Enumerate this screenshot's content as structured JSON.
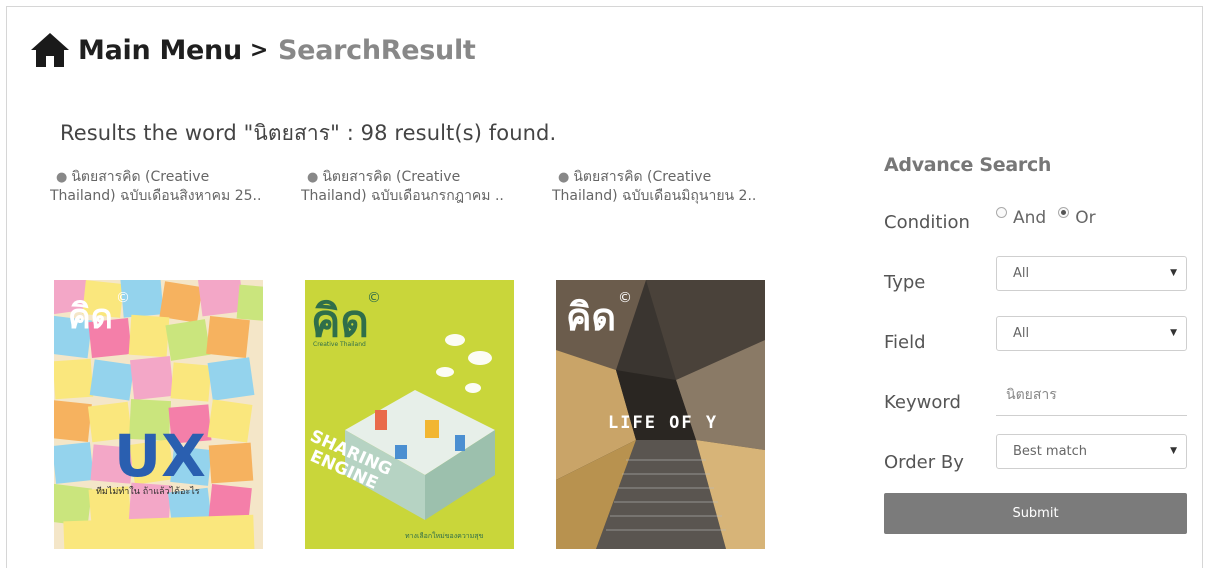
{
  "header": {
    "main_menu": "Main Menu",
    "separator": ">",
    "current": "SearchResult"
  },
  "summary": "Results the word \"นิตยสาร\" : 98 result(s) found.",
  "results": [
    {
      "title": "นิตยสารคิด (Creative Thailand) ฉบับเดือนสิงหาคม 25..",
      "cover_headline": "UX",
      "cover_subtitle": "ทีมไม่ทำใน ถ้าแล้วได้อะไร"
    },
    {
      "title": "นิตยสารคิด (Creative Thailand) ฉบับเดือนกรกฎาคม ..",
      "cover_headline": "SHARING ENGINE",
      "cover_subtitle": "ทางเลือกใหม่ของความสุข"
    },
    {
      "title": "นิตยสารคิด (Creative Thailand) ฉบับเดือนมิถุนายน 2..",
      "cover_headline": "LIFE OF Y",
      "cover_subtitle": ""
    }
  ],
  "covers": {
    "logo": "คิด",
    "logo_sub": "Creative Thailand",
    "copyright": "©"
  },
  "advance_search": {
    "title": "Advance Search",
    "condition_label": "Condition",
    "condition_options": [
      "And",
      "Or"
    ],
    "condition_selected": "Or",
    "type_label": "Type",
    "type_value": "All",
    "field_label": "Field",
    "field_value": "All",
    "keyword_label": "Keyword",
    "keyword_value": "นิตยสาร",
    "order_label": "Order By",
    "order_value": "Best match",
    "submit_label": "Submit"
  },
  "icons": {
    "home": "home-icon",
    "caret": "chevron-down-icon"
  }
}
